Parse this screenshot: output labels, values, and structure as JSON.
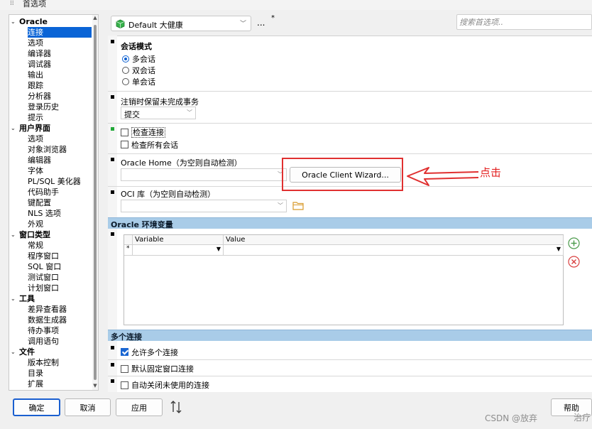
{
  "window": {
    "title": "首选项"
  },
  "tree": {
    "groups": [
      {
        "label": "Oracle",
        "items": [
          "连接",
          "选项",
          "编译器",
          "调试器",
          "输出",
          "跟踪",
          "分析器",
          "登录历史",
          "提示"
        ]
      },
      {
        "label": "用户界面",
        "items": [
          "选项",
          "对象浏览器",
          "编辑器",
          "字体",
          "PL/SQL 美化器",
          "代码助手",
          "键配置",
          "NLS 选项",
          "外观"
        ]
      },
      {
        "label": "窗口类型",
        "items": [
          "常规",
          "程序窗口",
          "SQL 窗口",
          "测试窗口",
          "计划窗口"
        ]
      },
      {
        "label": "工具",
        "items": [
          "差异查看器",
          "数据生成器",
          "待办事项",
          "调用语句"
        ]
      },
      {
        "label": "文件",
        "items": [
          "版本控制",
          "目录",
          "扩展"
        ]
      }
    ],
    "selected": "连接"
  },
  "toolbar": {
    "profile": "Default 大健康",
    "more_label": "...",
    "modified_mark": "*",
    "search_placeholder": "搜索首选项.."
  },
  "session_mode": {
    "title": "会话模式",
    "options": [
      "多会话",
      "双会话",
      "单会话"
    ],
    "selected_index": 0
  },
  "logoff": {
    "label": "注销时保留未完成事务",
    "value": "提交"
  },
  "check_connection": {
    "label": "检查连接",
    "checked": false
  },
  "check_all_sessions": {
    "label": "检查所有会话",
    "checked": false
  },
  "oracle_home": {
    "label": "Oracle Home（为空则自动检测）",
    "value": "",
    "wizard_button": "Oracle Client Wizard..."
  },
  "oci": {
    "label": "OCI 库（为空则自动检测）",
    "value": ""
  },
  "env_section": {
    "title": "Oracle 环境变量",
    "columns": [
      "Variable",
      "Value"
    ],
    "new_row_marker": "*"
  },
  "multi_section": {
    "title": "多个连接",
    "allow_multiple": {
      "label": "允许多个连接",
      "checked": true
    },
    "default_fixed": {
      "label": "默认固定窗口连接",
      "checked": false
    },
    "auto_close": {
      "label": "自动关闭未使用的连接",
      "checked": false
    }
  },
  "annotation": {
    "text": "点击",
    "color": "#e32020"
  },
  "footer": {
    "ok": "确定",
    "cancel": "取消",
    "apply": "应用",
    "help": "帮助",
    "watermark": "CSDN @放弃",
    "watermark2": "治疗"
  },
  "colors": {
    "accent": "#0a64d6",
    "section_header": "#a9cce8",
    "annotation": "#e03030"
  }
}
